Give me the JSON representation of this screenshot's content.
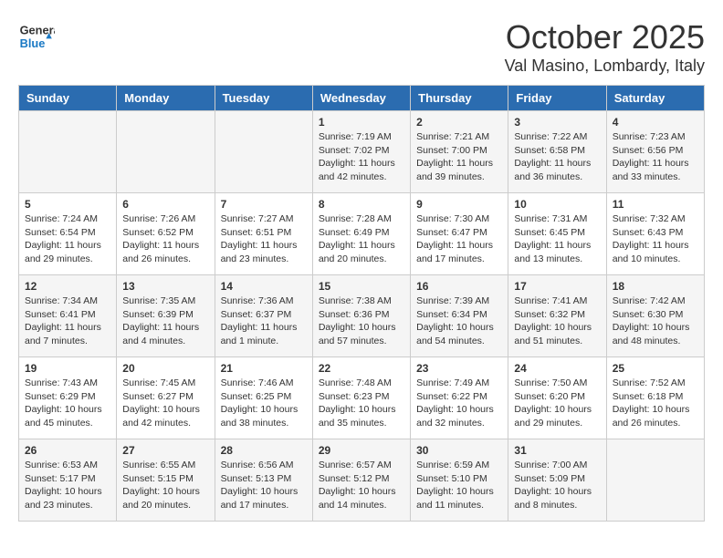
{
  "header": {
    "logo_general": "General",
    "logo_blue": "Blue",
    "month_title": "October 2025",
    "location": "Val Masino, Lombardy, Italy"
  },
  "days_of_week": [
    "Sunday",
    "Monday",
    "Tuesday",
    "Wednesday",
    "Thursday",
    "Friday",
    "Saturday"
  ],
  "weeks": [
    {
      "days": [
        {
          "number": "",
          "info": ""
        },
        {
          "number": "",
          "info": ""
        },
        {
          "number": "",
          "info": ""
        },
        {
          "number": "1",
          "info": "Sunrise: 7:19 AM\nSunset: 7:02 PM\nDaylight: 11 hours and 42 minutes."
        },
        {
          "number": "2",
          "info": "Sunrise: 7:21 AM\nSunset: 7:00 PM\nDaylight: 11 hours and 39 minutes."
        },
        {
          "number": "3",
          "info": "Sunrise: 7:22 AM\nSunset: 6:58 PM\nDaylight: 11 hours and 36 minutes."
        },
        {
          "number": "4",
          "info": "Sunrise: 7:23 AM\nSunset: 6:56 PM\nDaylight: 11 hours and 33 minutes."
        }
      ]
    },
    {
      "days": [
        {
          "number": "5",
          "info": "Sunrise: 7:24 AM\nSunset: 6:54 PM\nDaylight: 11 hours and 29 minutes."
        },
        {
          "number": "6",
          "info": "Sunrise: 7:26 AM\nSunset: 6:52 PM\nDaylight: 11 hours and 26 minutes."
        },
        {
          "number": "7",
          "info": "Sunrise: 7:27 AM\nSunset: 6:51 PM\nDaylight: 11 hours and 23 minutes."
        },
        {
          "number": "8",
          "info": "Sunrise: 7:28 AM\nSunset: 6:49 PM\nDaylight: 11 hours and 20 minutes."
        },
        {
          "number": "9",
          "info": "Sunrise: 7:30 AM\nSunset: 6:47 PM\nDaylight: 11 hours and 17 minutes."
        },
        {
          "number": "10",
          "info": "Sunrise: 7:31 AM\nSunset: 6:45 PM\nDaylight: 11 hours and 13 minutes."
        },
        {
          "number": "11",
          "info": "Sunrise: 7:32 AM\nSunset: 6:43 PM\nDaylight: 11 hours and 10 minutes."
        }
      ]
    },
    {
      "days": [
        {
          "number": "12",
          "info": "Sunrise: 7:34 AM\nSunset: 6:41 PM\nDaylight: 11 hours and 7 minutes."
        },
        {
          "number": "13",
          "info": "Sunrise: 7:35 AM\nSunset: 6:39 PM\nDaylight: 11 hours and 4 minutes."
        },
        {
          "number": "14",
          "info": "Sunrise: 7:36 AM\nSunset: 6:37 PM\nDaylight: 11 hours and 1 minute."
        },
        {
          "number": "15",
          "info": "Sunrise: 7:38 AM\nSunset: 6:36 PM\nDaylight: 10 hours and 57 minutes."
        },
        {
          "number": "16",
          "info": "Sunrise: 7:39 AM\nSunset: 6:34 PM\nDaylight: 10 hours and 54 minutes."
        },
        {
          "number": "17",
          "info": "Sunrise: 7:41 AM\nSunset: 6:32 PM\nDaylight: 10 hours and 51 minutes."
        },
        {
          "number": "18",
          "info": "Sunrise: 7:42 AM\nSunset: 6:30 PM\nDaylight: 10 hours and 48 minutes."
        }
      ]
    },
    {
      "days": [
        {
          "number": "19",
          "info": "Sunrise: 7:43 AM\nSunset: 6:29 PM\nDaylight: 10 hours and 45 minutes."
        },
        {
          "number": "20",
          "info": "Sunrise: 7:45 AM\nSunset: 6:27 PM\nDaylight: 10 hours and 42 minutes."
        },
        {
          "number": "21",
          "info": "Sunrise: 7:46 AM\nSunset: 6:25 PM\nDaylight: 10 hours and 38 minutes."
        },
        {
          "number": "22",
          "info": "Sunrise: 7:48 AM\nSunset: 6:23 PM\nDaylight: 10 hours and 35 minutes."
        },
        {
          "number": "23",
          "info": "Sunrise: 7:49 AM\nSunset: 6:22 PM\nDaylight: 10 hours and 32 minutes."
        },
        {
          "number": "24",
          "info": "Sunrise: 7:50 AM\nSunset: 6:20 PM\nDaylight: 10 hours and 29 minutes."
        },
        {
          "number": "25",
          "info": "Sunrise: 7:52 AM\nSunset: 6:18 PM\nDaylight: 10 hours and 26 minutes."
        }
      ]
    },
    {
      "days": [
        {
          "number": "26",
          "info": "Sunrise: 6:53 AM\nSunset: 5:17 PM\nDaylight: 10 hours and 23 minutes."
        },
        {
          "number": "27",
          "info": "Sunrise: 6:55 AM\nSunset: 5:15 PM\nDaylight: 10 hours and 20 minutes."
        },
        {
          "number": "28",
          "info": "Sunrise: 6:56 AM\nSunset: 5:13 PM\nDaylight: 10 hours and 17 minutes."
        },
        {
          "number": "29",
          "info": "Sunrise: 6:57 AM\nSunset: 5:12 PM\nDaylight: 10 hours and 14 minutes."
        },
        {
          "number": "30",
          "info": "Sunrise: 6:59 AM\nSunset: 5:10 PM\nDaylight: 10 hours and 11 minutes."
        },
        {
          "number": "31",
          "info": "Sunrise: 7:00 AM\nSunset: 5:09 PM\nDaylight: 10 hours and 8 minutes."
        },
        {
          "number": "",
          "info": ""
        }
      ]
    }
  ]
}
